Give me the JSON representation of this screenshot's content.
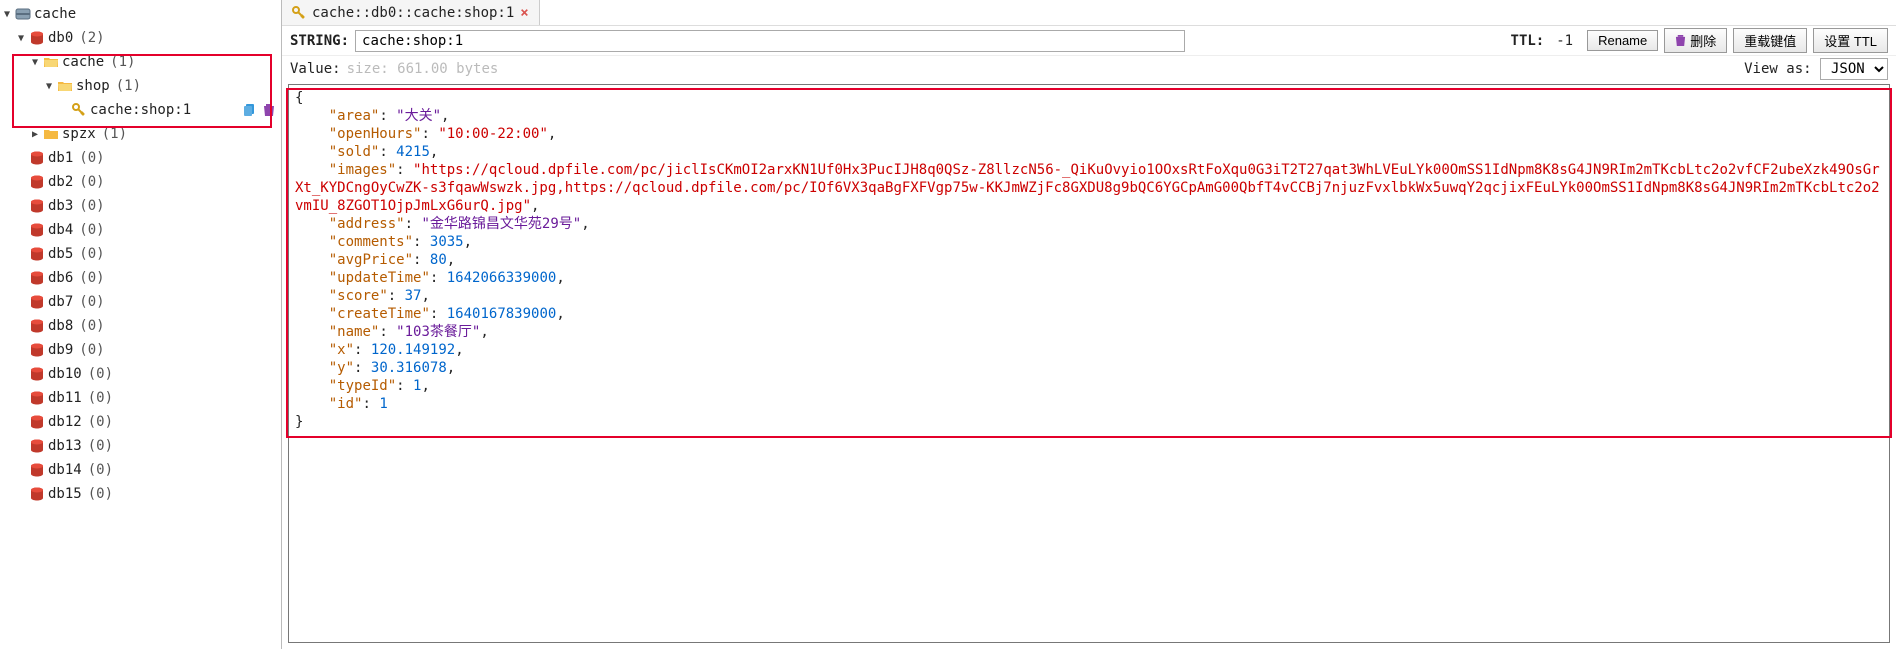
{
  "sidebar": {
    "root": "cache",
    "db0": {
      "name": "db0",
      "count": "(2)"
    },
    "cache_folder": {
      "name": "cache",
      "count": "(1)"
    },
    "shop_folder": {
      "name": "shop",
      "count": "(1)"
    },
    "key_item": {
      "name": "cache:shop:1"
    },
    "spzx_folder": {
      "name": "spzx",
      "count": "(1)"
    },
    "dbs": [
      {
        "name": "db1",
        "count": "(0)"
      },
      {
        "name": "db2",
        "count": "(0)"
      },
      {
        "name": "db3",
        "count": "(0)"
      },
      {
        "name": "db4",
        "count": "(0)"
      },
      {
        "name": "db5",
        "count": "(0)"
      },
      {
        "name": "db6",
        "count": "(0)"
      },
      {
        "name": "db7",
        "count": "(0)"
      },
      {
        "name": "db8",
        "count": "(0)"
      },
      {
        "name": "db9",
        "count": "(0)"
      },
      {
        "name": "db10",
        "count": "(0)"
      },
      {
        "name": "db11",
        "count": "(0)"
      },
      {
        "name": "db12",
        "count": "(0)"
      },
      {
        "name": "db13",
        "count": "(0)"
      },
      {
        "name": "db14",
        "count": "(0)"
      },
      {
        "name": "db15",
        "count": "(0)"
      }
    ]
  },
  "tab": {
    "title": "cache::db0::cache:shop:1",
    "close": "×"
  },
  "infobar": {
    "type_label": "STRING:",
    "key_value": "cache:shop:1",
    "ttl_label": "TTL:",
    "ttl_value": "-1",
    "rename_btn": "Rename",
    "delete_btn": "删除",
    "reload_btn": "重载键值",
    "setttl_btn": "设置 TTL"
  },
  "meta": {
    "value_label": "Value:",
    "size_text": "size: 661.00 bytes",
    "viewas_label": "View as:",
    "viewas_value": "JSON"
  },
  "value": {
    "area_k": "area",
    "area_v": "大关",
    "openHours_k": "openHours",
    "openHours_v": "10:00-22:00",
    "sold_k": "sold",
    "sold_v": "4215",
    "images_k": "images",
    "images_v": "https://qcloud.dpfile.com/pc/jiclIsCKmOI2arxKN1Uf0Hx3PucIJH8q0QSz-Z8llzcN56-_QiKuOvyio1OOxsRtFoXqu0G3iT2T27qat3WhLVEuLYk00OmSS1IdNpm8K8sG4JN9RIm2mTKcbLtc2o2vfCF2ubeXzk49OsGrXt_KYDCngOyCwZK-s3fqawWswzk.jpg,https://qcloud.dpfile.com/pc/IOf6VX3qaBgFXFVgp75w-KKJmWZjFc8GXDU8g9bQC6YGCpAmG00QbfT4vCCBj7njuzFvxlbkWx5uwqY2qcjixFEuLYk00OmSS1IdNpm8K8sG4JN9RIm2mTKcbLtc2o2vmIU_8ZGOT1OjpJmLxG6urQ.jpg",
    "address_k": "address",
    "address_v": "金华路锦昌文华苑29号",
    "comments_k": "comments",
    "comments_v": "3035",
    "avgPrice_k": "avgPrice",
    "avgPrice_v": "80",
    "updateTime_k": "updateTime",
    "updateTime_v": "1642066339000",
    "score_k": "score",
    "score_v": "37",
    "createTime_k": "createTime",
    "createTime_v": "1640167839000",
    "name_k": "name",
    "name_v": "103茶餐厅",
    "x_k": "x",
    "x_v": "120.149192",
    "y_k": "y",
    "y_v": "30.316078",
    "typeId_k": "typeId",
    "typeId_v": "1",
    "id_k": "id",
    "id_v": "1"
  }
}
